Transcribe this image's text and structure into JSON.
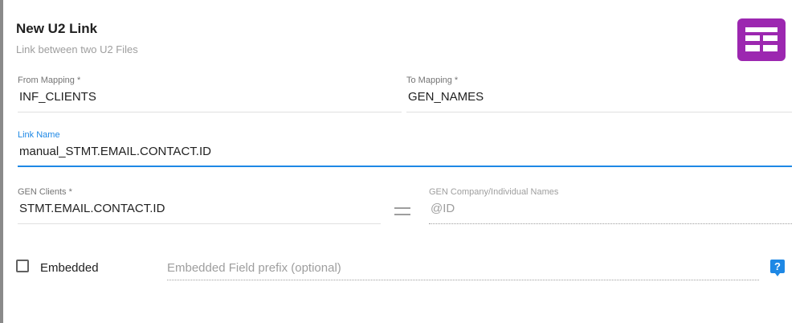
{
  "dialog": {
    "title": "New U2 Link",
    "subtitle": "Link between two U2 Files",
    "badge_icon": "table-grid-icon",
    "badge_color": "#9c27b0"
  },
  "from_mapping": {
    "label": "From Mapping *",
    "value": "INF_CLIENTS"
  },
  "to_mapping": {
    "label": "To Mapping *",
    "value": "GEN_NAMES"
  },
  "link_name": {
    "label": "Link Name",
    "value": "manual_STMT.EMAIL.CONTACT.ID",
    "accent_color": "#1e88e5"
  },
  "gen_clients": {
    "label": "GEN Clients *",
    "value": "STMT.EMAIL.CONTACT.ID"
  },
  "equals_icon": "equals-icon",
  "gen_names": {
    "label": "GEN Company/Individual Names",
    "value": "@ID"
  },
  "embedded": {
    "label": "Embedded",
    "checked": false,
    "prefix_placeholder": "Embedded Field prefix (optional)",
    "help_icon": "help-icon",
    "help_color": "#1e88e5"
  }
}
